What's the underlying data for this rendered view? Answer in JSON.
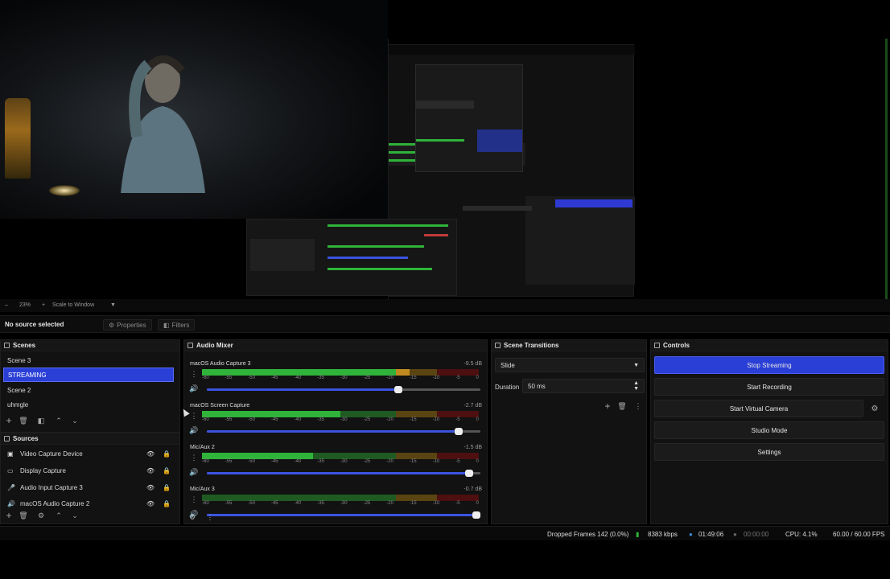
{
  "preview": {
    "zoom_label": "23%",
    "scale_mode": "Scale to Window"
  },
  "source_toolbar": {
    "no_source": "No source selected",
    "properties": "Properties",
    "filters": "Filters"
  },
  "scenes": {
    "title": "Scenes",
    "items": [
      {
        "label": "Scene 3",
        "selected": false
      },
      {
        "label": "STREAMING",
        "selected": true
      },
      {
        "label": "Scene 2",
        "selected": false
      },
      {
        "label": "uhmgle",
        "selected": false
      }
    ]
  },
  "sources": {
    "title": "Sources",
    "items": [
      {
        "label": "Video Capture Device",
        "icon": "camera-icon"
      },
      {
        "label": "Display Capture",
        "icon": "monitor-icon"
      },
      {
        "label": "Audio Input Capture 3",
        "icon": "mic-icon"
      },
      {
        "label": "macOS Audio Capture 2",
        "icon": "speaker-icon"
      }
    ]
  },
  "mixer": {
    "title": "Audio Mixer",
    "tick_labels": [
      "-60",
      "-55",
      "-50",
      "-45",
      "-40",
      "-35",
      "-30",
      "-25",
      "-20",
      "-15",
      "-10",
      "-5",
      "0"
    ],
    "channels": [
      {
        "name": "macOS Audio Capture 3",
        "db": "-9.5 dB",
        "level": 0.75,
        "volume": 0.7
      },
      {
        "name": "macOS Screen Capture",
        "db": "-2.7 dB",
        "level": 0.5,
        "volume": 0.92
      },
      {
        "name": "Mic/Aux 2",
        "db": "-1.5 dB",
        "level": 0.4,
        "volume": 0.96
      },
      {
        "name": "Mic/Aux 3",
        "db": "-0.7 dB",
        "level": 0.0,
        "volume": 1.0
      }
    ]
  },
  "transitions": {
    "title": "Scene Transitions",
    "selected": "Slide",
    "duration_label": "Duration",
    "duration_value": "50 ms"
  },
  "controls": {
    "title": "Controls",
    "stop_streaming": "Stop Streaming",
    "start_recording": "Start Recording",
    "start_virtual_camera": "Start Virtual Camera",
    "studio_mode": "Studio Mode",
    "settings": "Settings"
  },
  "status": {
    "dropped_frames": "Dropped Frames 142 (0.0%)",
    "bitrate": "8383 kbps",
    "stream_time": "01:49:06",
    "record_time": "00:00:00",
    "cpu": "CPU: 4.1%",
    "fps": "60.00 / 60.00 FPS"
  },
  "colors": {
    "accent": "#2a3fd6",
    "meter_green": "#2fb33a",
    "meter_yellow": "#c08a1e",
    "meter_red": "#a01c1c"
  }
}
